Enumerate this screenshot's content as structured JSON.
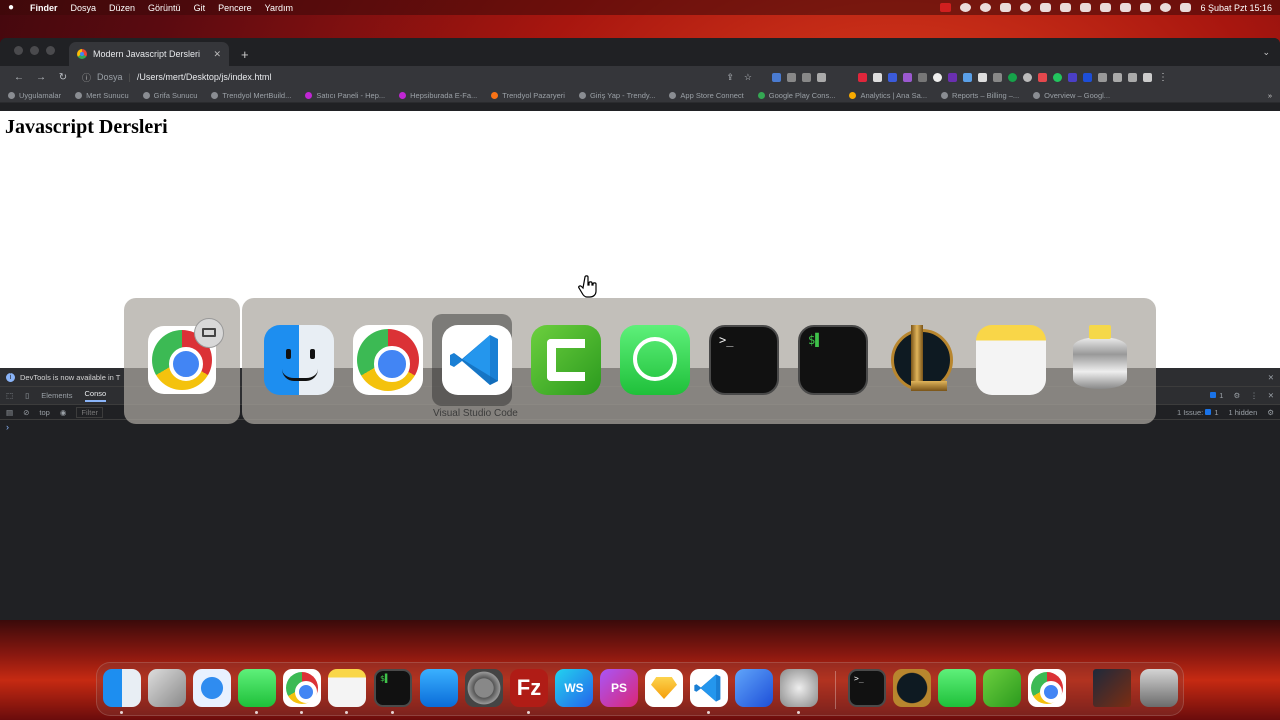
{
  "menubar": {
    "app": "Finder",
    "items": [
      "Dosya",
      "Düzen",
      "Görüntü",
      "Git",
      "Pencere",
      "Yardım"
    ],
    "datetime": "6 Şubat Pzt  15:16"
  },
  "browser": {
    "tab_title": "Modern Javascript Dersleri",
    "url_scheme": "Dosya",
    "url": "/Users/mert/Desktop/js/index.html",
    "bookmarks": [
      "Uygulamalar",
      "Mert Sunucu",
      "Grifa Sunucu",
      "Trendyol MertBuild...",
      "Satıcı Paneli - Hep...",
      "Hepsiburada E-Fa...",
      "Trendyol Pazaryeri",
      "Giriş Yap - Trendy...",
      "App Store Connect",
      "Google Play Cons...",
      "Analytics | Ana Sa...",
      "Reports – Billing –...",
      "Overview – Googl..."
    ]
  },
  "page": {
    "heading": "Javascript Dersleri"
  },
  "devtools": {
    "info": "DevTools is now available in T",
    "tab_elements": "Elements",
    "tab_console": "Conso",
    "context": "top",
    "filter_placeholder": "Filter",
    "issues_count": "1",
    "issues_label": "1 Issue:",
    "issues_badge": "1",
    "hidden_label": "1 hidden",
    "prompt": "›"
  },
  "switcher": {
    "selected_label": "Visual Studio Code"
  },
  "colors": {
    "accent": "#8ab4f8",
    "page_bg": "#ffffff",
    "devtools_bg": "#202124"
  }
}
